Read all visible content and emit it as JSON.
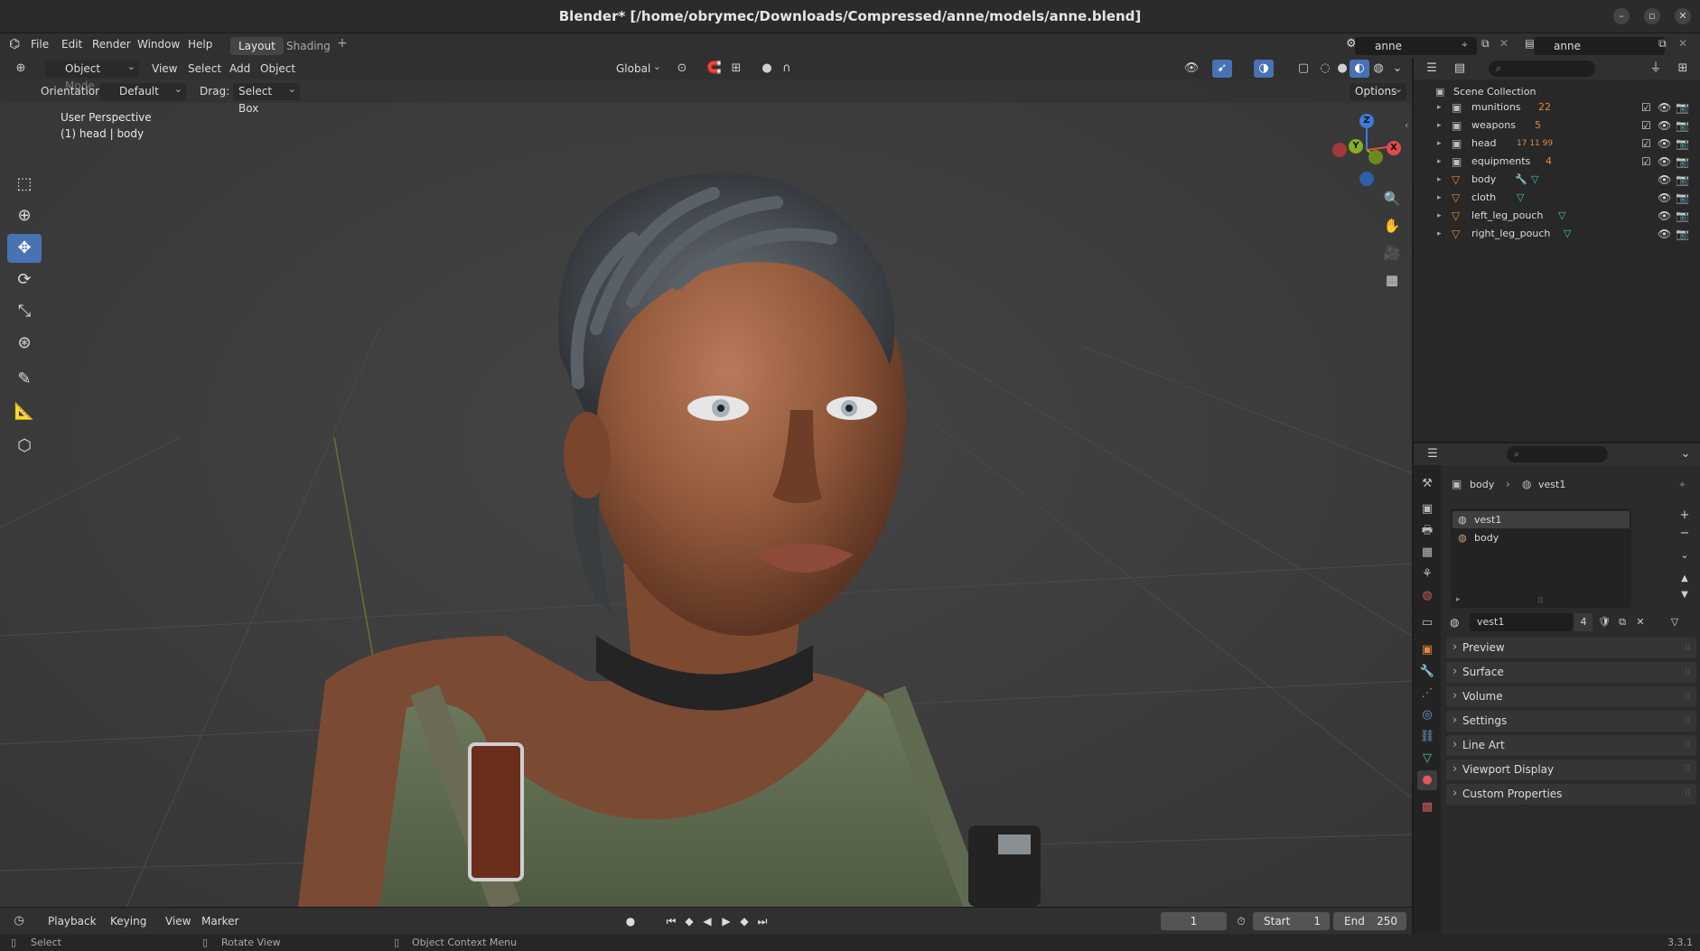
{
  "window": {
    "title": "Blender* [/home/obrymec/Downloads/Compressed/anne/models/anne.blend]",
    "controls": [
      "–",
      "▫",
      "✕"
    ]
  },
  "menu": {
    "items": [
      "File",
      "Edit",
      "Render",
      "Window",
      "Help"
    ],
    "workspaces": [
      "Layout",
      "Shading"
    ],
    "add_workspace": "+",
    "scene_name": "anne",
    "view_layer_name": "anne"
  },
  "viewport": {
    "mode": "Object Mode",
    "menus": [
      "View",
      "Select",
      "Add",
      "Object"
    ],
    "transform_orientation": "Global",
    "orientation_label": "Orientation:",
    "orientation_value": "Default",
    "drag_label": "Drag:",
    "drag_value": "Select Box",
    "options_label": "Options",
    "perspective": "User Perspective",
    "active_object": "(1) head | body",
    "gizmo": {
      "x": "X",
      "y": "Y",
      "z": "Z"
    },
    "colors": {
      "x_axis": "#e34a4a",
      "y_axis": "#86b11d",
      "z_axis": "#3d7bd9",
      "active_tool": "#4772b3"
    }
  },
  "outliner": {
    "root": "Scene Collection",
    "rows": [
      {
        "name": "munitions",
        "type": "collection",
        "badge": "22",
        "checked": true
      },
      {
        "name": "weapons",
        "type": "collection",
        "badge": "5",
        "checked": true
      },
      {
        "name": "head",
        "type": "collection",
        "badge": "17 11 99",
        "checked": true
      },
      {
        "name": "equipments",
        "type": "collection",
        "badge": "4",
        "checked": true
      },
      {
        "name": "body",
        "type": "mesh",
        "badge": "",
        "checked": false
      },
      {
        "name": "cloth",
        "type": "mesh",
        "badge": "",
        "checked": false
      },
      {
        "name": "left_leg_pouch",
        "type": "mesh",
        "badge": "",
        "checked": false
      },
      {
        "name": "right_leg_pouch",
        "type": "mesh",
        "badge": "",
        "checked": false
      }
    ]
  },
  "properties": {
    "breadcrumb": {
      "object": "body",
      "material": "vest1"
    },
    "slots": [
      "vest1",
      "body"
    ],
    "material_name": "vest1",
    "user_count": "4",
    "panels": [
      "Preview",
      "Surface",
      "Volume",
      "Settings",
      "Line Art",
      "Viewport Display",
      "Custom Properties"
    ]
  },
  "timeline": {
    "menus": [
      "Playback",
      "Keying",
      "View",
      "Marker"
    ],
    "current_frame": "1",
    "start_label": "Start",
    "start": "1",
    "end_label": "End",
    "end": "250"
  },
  "status": {
    "select": "Select",
    "rotate": "Rotate View",
    "context_menu": "Object Context Menu",
    "version": "3.3.1"
  }
}
